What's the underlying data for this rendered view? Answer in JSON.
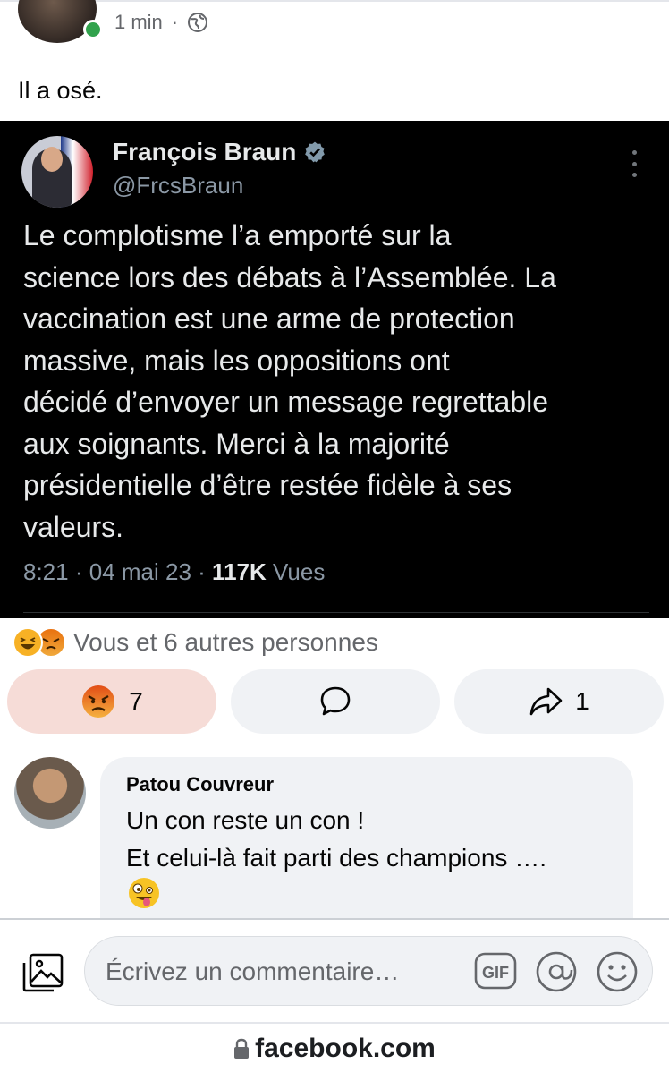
{
  "post": {
    "time": "1 min",
    "separator": "·",
    "text": "Il a osé."
  },
  "tweet": {
    "name": "François Braun",
    "handle": "@FrcsBraun",
    "body": "Le complotisme l’a emporté sur la\nscience lors des débats à l’Assemblée. La\nvaccination est une arme de protection\nmassive, mais les oppositions ont\ndécidé d’envoyer un message regrettable\naux soignants. Merci à la majorité\nprésidentielle d’être restée fidèle à ses\nvaleurs.",
    "time": "8:21",
    "date": "04 mai 23",
    "views_count": "117K",
    "views_label": "Vues"
  },
  "reactions": {
    "summary": "Vous et 6 autres personnes",
    "icons": [
      "haha-emoji",
      "angry-emoji"
    ]
  },
  "actions": {
    "react_count": "7",
    "share_count": "1"
  },
  "comment": {
    "author": "Patou Couvreur",
    "text": "Un con reste un con !\nEt celui-là fait parti des champions …."
  },
  "composer": {
    "placeholder": "Écrivez un commentaire…",
    "gif_label": "GIF"
  },
  "browser": {
    "url": "facebook.com"
  },
  "colors": {
    "tweet_bg": "#000000",
    "react_button_bg": "#f6dcd7",
    "button_bg": "#f0f2f5",
    "online": "#31a24c"
  }
}
